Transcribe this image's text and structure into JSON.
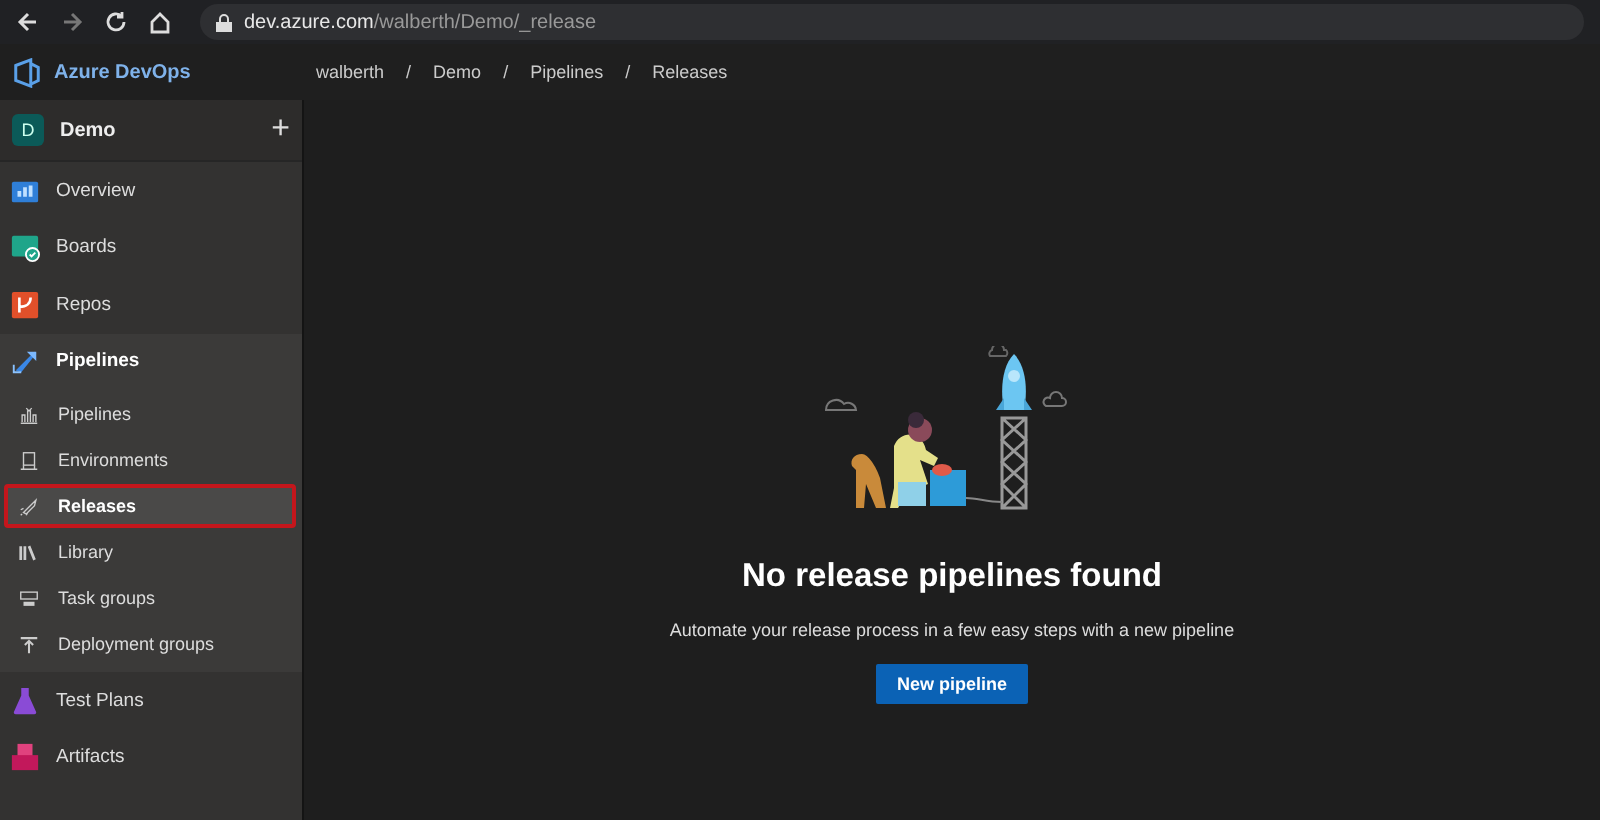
{
  "browser": {
    "url_host": "dev.azure.com",
    "url_path": "/walberth/Demo/_release"
  },
  "header": {
    "product": "Azure DevOps",
    "breadcrumb": [
      "walberth",
      "Demo",
      "Pipelines",
      "Releases"
    ],
    "separator": "/"
  },
  "sidebar": {
    "project": {
      "initial": "D",
      "name": "Demo",
      "add": "+"
    },
    "items": [
      {
        "label": "Overview",
        "selected": false
      },
      {
        "label": "Boards",
        "selected": false
      },
      {
        "label": "Repos",
        "selected": false
      },
      {
        "label": "Pipelines",
        "selected": true,
        "children": [
          {
            "label": "Pipelines",
            "selected": false
          },
          {
            "label": "Environments",
            "selected": false
          },
          {
            "label": "Releases",
            "selected": true
          },
          {
            "label": "Library",
            "selected": false
          },
          {
            "label": "Task groups",
            "selected": false
          },
          {
            "label": "Deployment groups",
            "selected": false
          }
        ]
      },
      {
        "label": "Test Plans",
        "selected": false
      },
      {
        "label": "Artifacts",
        "selected": false
      }
    ]
  },
  "empty_state": {
    "title": "No release pipelines found",
    "message": "Automate your release process in a few easy steps with a new pipeline",
    "button": "New pipeline"
  }
}
